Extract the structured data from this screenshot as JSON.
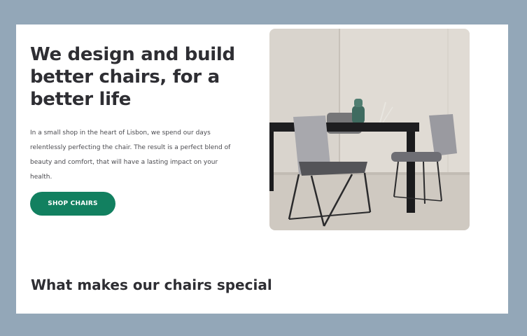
{
  "hero": {
    "title": "We design and build better chairs, for a better life",
    "description": "In a small shop in the heart of Lisbon, we spend our days relentlessly perfecting the chair. The result is a perfect blend of beauty and comfort, that will have a lasting impact on your health.",
    "cta_label": "SHOP CHAIRS",
    "image_icon": "dining-table-chairs-photo"
  },
  "features": {
    "title": "What makes our chairs special"
  },
  "colors": {
    "page_background": "#93a7b8",
    "accent": "#128060",
    "heading_text": "#2e2e33"
  }
}
